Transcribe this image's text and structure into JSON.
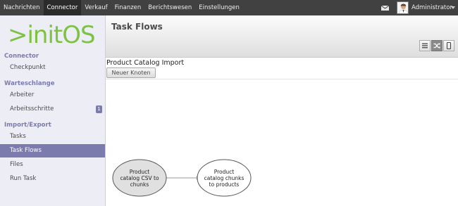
{
  "topbar": {
    "menu": [
      "Nachrichten",
      "Connector",
      "Verkauf",
      "Finanzen",
      "Berichtswesen",
      "Einstellungen"
    ],
    "active_index": 1,
    "user_name": "Administrator"
  },
  "sidebar": {
    "logo_text": ">initOS",
    "sections": [
      {
        "title": "Connector",
        "items": [
          {
            "label": "Checkpunkt"
          }
        ]
      },
      {
        "title": "Warteschlange",
        "items": [
          {
            "label": "Arbeiter"
          },
          {
            "label": "Arbeitsschritte",
            "badge": "1"
          }
        ]
      },
      {
        "title": "Import/Export",
        "items": [
          {
            "label": "Tasks"
          },
          {
            "label": "Task Flows",
            "active": true
          },
          {
            "label": "Files"
          },
          {
            "label": "Run Task"
          }
        ]
      }
    ]
  },
  "header": {
    "title": "Task Flows",
    "view_switches": [
      {
        "icon": "list-view-icon",
        "active": false
      },
      {
        "icon": "diagram-view-icon",
        "active": true
      },
      {
        "icon": "form-view-icon",
        "active": false
      }
    ]
  },
  "diagram": {
    "title": "Product Catalog Import",
    "new_node_label": "Neuer Knoten",
    "nodes": [
      {
        "lines": [
          "Product",
          "catalog CSV to",
          "chunks"
        ],
        "fill": "#e0e0e0"
      },
      {
        "lines": [
          "Product",
          "catalog chunks",
          "to products"
        ],
        "fill": "#ffffff"
      }
    ]
  },
  "colors": {
    "topbar": "#414141",
    "accent": "#7c7bad",
    "sidebar_bg": "#ededf6",
    "logo_green": "#7dc242"
  }
}
